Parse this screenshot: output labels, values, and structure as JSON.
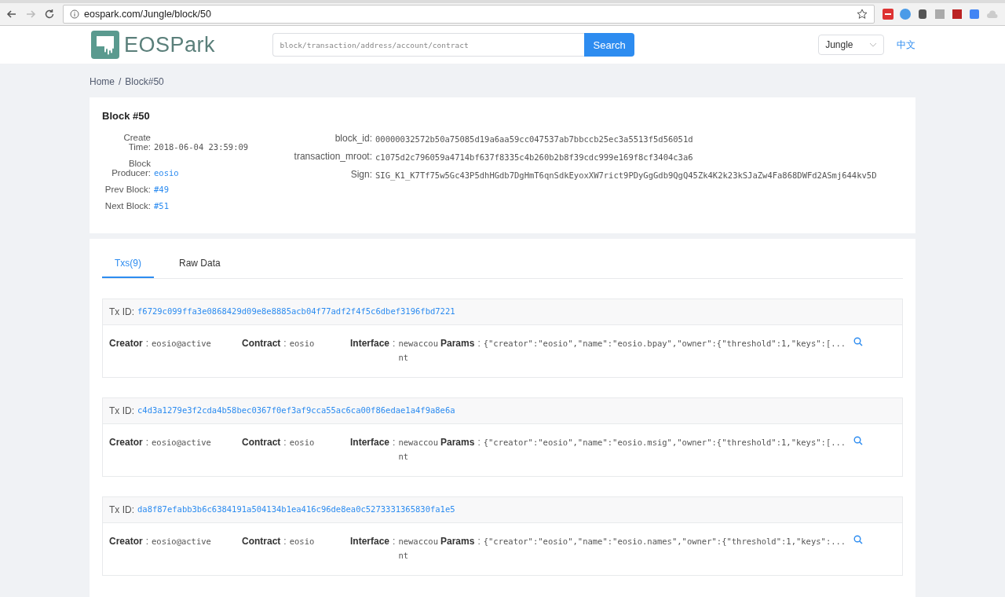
{
  "browser": {
    "url": "eospark.com/Jungle/block/50"
  },
  "header": {
    "logo": "EOSPark",
    "search": {
      "placeholder": "block/transaction/address/account/contract",
      "button": "Search"
    },
    "network": "Jungle",
    "language": "中文"
  },
  "breadcrumb": {
    "items": [
      "Home",
      "Block#50"
    ],
    "separator": "/"
  },
  "block": {
    "title": "Block #50",
    "left": [
      {
        "label": "Create Time:",
        "value": "2018-06-04 23:59:09",
        "link": false
      },
      {
        "label": "Block Producer:",
        "value": "eosio",
        "link": true
      },
      {
        "label": "Prev Block:",
        "value": "#49",
        "link": true
      },
      {
        "label": "Next Block:",
        "value": "#51",
        "link": true
      }
    ],
    "right": [
      {
        "label": "block_id:",
        "value": "00000032572b50a75085d19a6aa59cc047537ab7bbccb25ec3a5513f5d56051d"
      },
      {
        "label": "transaction_mroot:",
        "value": "c1075d2c796059a4714bf637f8335c4b260b2b8f39cdc999e169f8cf3404c3a6"
      },
      {
        "label": "Sign:",
        "value": "SIG_K1_K7Tf75w5Gc43P5dhHGdb7DgHmT6qnSdkEyoxXW7rict9PDyGgGdb9QgQ45Zk4K2k23kSJaZw4Fa868DWFd2ASmj644kv5D"
      }
    ]
  },
  "tabs": [
    {
      "label": "Txs(9)",
      "selected": true
    },
    {
      "label": "Raw Data",
      "selected": false
    }
  ],
  "transactions": [
    {
      "tx_id_label": "Tx ID:",
      "tx_id": "f6729c099ffa3e0868429d09e8e8885acb04f77adf2f4f5c6dbef3196fbd7221",
      "fields": [
        {
          "kind": "creator",
          "label": "Creator",
          "separator": ":",
          "value": "eosio@active"
        },
        {
          "kind": "contract",
          "label": "Contract",
          "separator": ":",
          "value": "eosio"
        },
        {
          "kind": "interface",
          "label": "Interface",
          "separator": ":",
          "value": "newaccount"
        },
        {
          "kind": "params",
          "label": "Params",
          "separator": ":",
          "value": "{\"creator\":\"eosio\",\"name\":\"eosio.bpay\",\"owner\":{\"threshold\":1,\"keys\":[..."
        }
      ]
    },
    {
      "tx_id_label": "Tx ID:",
      "tx_id": "c4d3a1279e3f2cda4b58bec0367f0ef3af9cca55ac6ca00f86edae1a4f9a8e6a",
      "fields": [
        {
          "kind": "creator",
          "label": "Creator",
          "separator": ":",
          "value": "eosio@active"
        },
        {
          "kind": "contract",
          "label": "Contract",
          "separator": ":",
          "value": "eosio"
        },
        {
          "kind": "interface",
          "label": "Interface",
          "separator": ":",
          "value": "newaccount"
        },
        {
          "kind": "params",
          "label": "Params",
          "separator": ":",
          "value": "{\"creator\":\"eosio\",\"name\":\"eosio.msig\",\"owner\":{\"threshold\":1,\"keys\":[..."
        }
      ]
    },
    {
      "tx_id_label": "Tx ID:",
      "tx_id": "da8f87efabb3b6c6384191a504134b1ea416c96de8ea0c5273331365830fa1e5",
      "fields": [
        {
          "kind": "creator",
          "label": "Creator",
          "separator": ":",
          "value": "eosio@active"
        },
        {
          "kind": "contract",
          "label": "Contract",
          "separator": ":",
          "value": "eosio"
        },
        {
          "kind": "interface",
          "label": "Interface",
          "separator": ":",
          "value": "newaccount"
        },
        {
          "kind": "params",
          "label": "Params",
          "separator": ":",
          "value": "{\"creator\":\"eosio\",\"name\":\"eosio.names\",\"owner\":{\"threshold\":1,\"keys\":..."
        }
      ]
    }
  ]
}
